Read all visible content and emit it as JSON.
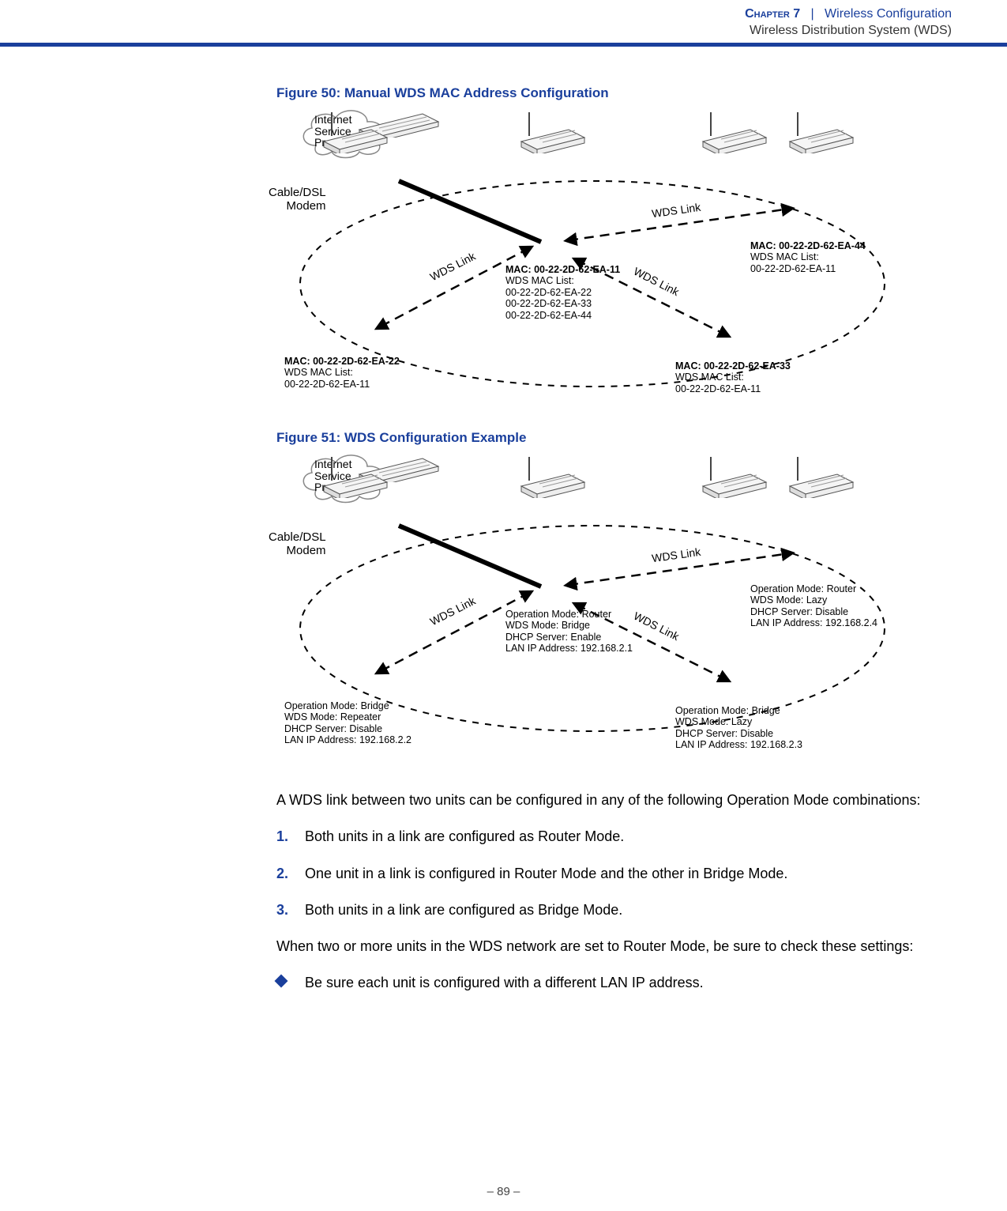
{
  "header": {
    "chapter_label": "Chapter 7",
    "separator": "|",
    "topic": "Wireless Configuration",
    "subtopic": "Wireless Distribution System (WDS)"
  },
  "figure50": {
    "title": "Figure 50:  Manual WDS MAC Address Configuration",
    "cloud": "Internet\nService\nProvider",
    "modem_label": "Cable/DSL\nModem",
    "wds_link": "WDS Link",
    "ap_center": {
      "mac": "MAC: 00-22-2D-62-EA-11",
      "list_title": "WDS MAC List:",
      "list": [
        "00-22-2D-62-EA-22",
        "00-22-2D-62-EA-33",
        "00-22-2D-62-EA-44"
      ]
    },
    "ap_left": {
      "mac": "MAC: 00-22-2D-62-EA-22",
      "list_title": "WDS MAC List:",
      "list": [
        "00-22-2D-62-EA-11"
      ]
    },
    "ap_right_bottom": {
      "mac": "MAC: 00-22-2D-62-EA-33",
      "list_title": "WDS MAC List:",
      "list": [
        "00-22-2D-62-EA-11"
      ]
    },
    "ap_right_top": {
      "mac": "MAC: 00-22-2D-62-EA-44",
      "list_title": "WDS MAC List:",
      "list": [
        "00-22-2D-62-EA-11"
      ]
    }
  },
  "figure51": {
    "title": "Figure 51:  WDS Configuration Example",
    "cloud": "Internet\nService\nProvider",
    "modem_label": "Cable/DSL\nModem",
    "wds_link": "WDS Link",
    "ap_center": {
      "l1": "Operation Mode: Router",
      "l2": "WDS Mode: Bridge",
      "l3": "DHCP Server: Enable",
      "l4": "LAN IP Address: 192.168.2.1"
    },
    "ap_left": {
      "l1": "Operation Mode: Bridge",
      "l2": "WDS Mode: Repeater",
      "l3": "DHCP Server: Disable",
      "l4": "LAN IP Address: 192.168.2.2"
    },
    "ap_right_bottom": {
      "l1": "Operation Mode: Bridge",
      "l2": "WDS Mode: Lazy",
      "l3": "DHCP Server: Disable",
      "l4": "LAN IP Address: 192.168.2.3"
    },
    "ap_right_top": {
      "l1": "Operation Mode: Router",
      "l2": "WDS Mode: Lazy",
      "l3": "DHCP Server: Disable",
      "l4": "LAN IP Address: 192.168.2.4"
    }
  },
  "body": {
    "intro": "A WDS link between two units can be configured in any of the following Operation Mode combinations:",
    "list": [
      "Both units in a link are configured as Router Mode.",
      "One unit in a link is configured in Router Mode and the other in Bridge Mode.",
      "Both units in a link are configured as Bridge Mode."
    ],
    "para2": "When two or more units in the WDS network are set to Router Mode, be sure to check these settings:",
    "bullet": "Be sure each unit is configured with a different LAN IP address."
  },
  "page_num": "– 89 –"
}
